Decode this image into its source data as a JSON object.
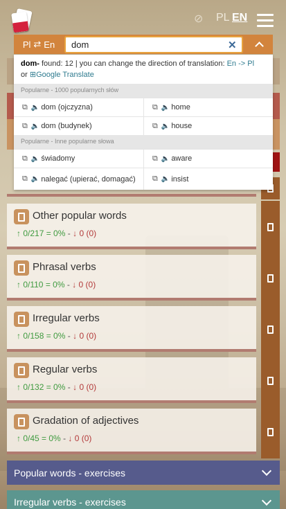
{
  "header": {
    "lang_pl": "PL",
    "lang_en": "EN"
  },
  "search": {
    "direction_from": "Pl",
    "direction_to": "En",
    "value": "dom",
    "clear_label": "✕"
  },
  "results": {
    "query_bold": "dom-",
    "found_text": " found: 12 | you can change the direction of translation: ",
    "direction_link": "En -> Pl",
    "or_text": "or ",
    "google_translate": "Google Translate",
    "sections": [
      {
        "heading": "Popularne - 1000 popularnych słów",
        "rows": [
          {
            "pl": "dom (ojczyzna)",
            "en": "home"
          },
          {
            "pl": "dom (budynek)",
            "en": "house"
          }
        ]
      },
      {
        "heading": "Popularne - Inne popularne słowa",
        "rows": [
          {
            "pl": "świadomy",
            "en": "aware"
          },
          {
            "pl": "nalegać (upierać, domagać)",
            "en": "insist"
          }
        ]
      }
    ]
  },
  "lessons": [
    {
      "title": "Other popular words",
      "progress": "0/217 = 0%",
      "errors": "0 (0)"
    },
    {
      "title": "Phrasal verbs",
      "progress": "0/110 = 0%",
      "errors": "0 (0)"
    },
    {
      "title": "Irregular verbs",
      "progress": "0/158 = 0%",
      "errors": "0 (0)"
    },
    {
      "title": "Regular verbs",
      "progress": "0/132 = 0%",
      "errors": "0 (0)"
    },
    {
      "title": "Gradation of adjectives",
      "progress": "0/45 = 0%",
      "errors": "0 (0)"
    }
  ],
  "accordions": [
    {
      "label": "Popular words - exercises",
      "color": "#565b8c"
    },
    {
      "label": "Irregular verbs - exercises",
      "color": "#5c968f"
    }
  ],
  "colors": {
    "accent_orange": "#d2843d",
    "card_border": "#b17b70",
    "side_button": "#9a5c2b",
    "progress_up": "#3f9a3f",
    "errors_down": "#b33a3a"
  }
}
